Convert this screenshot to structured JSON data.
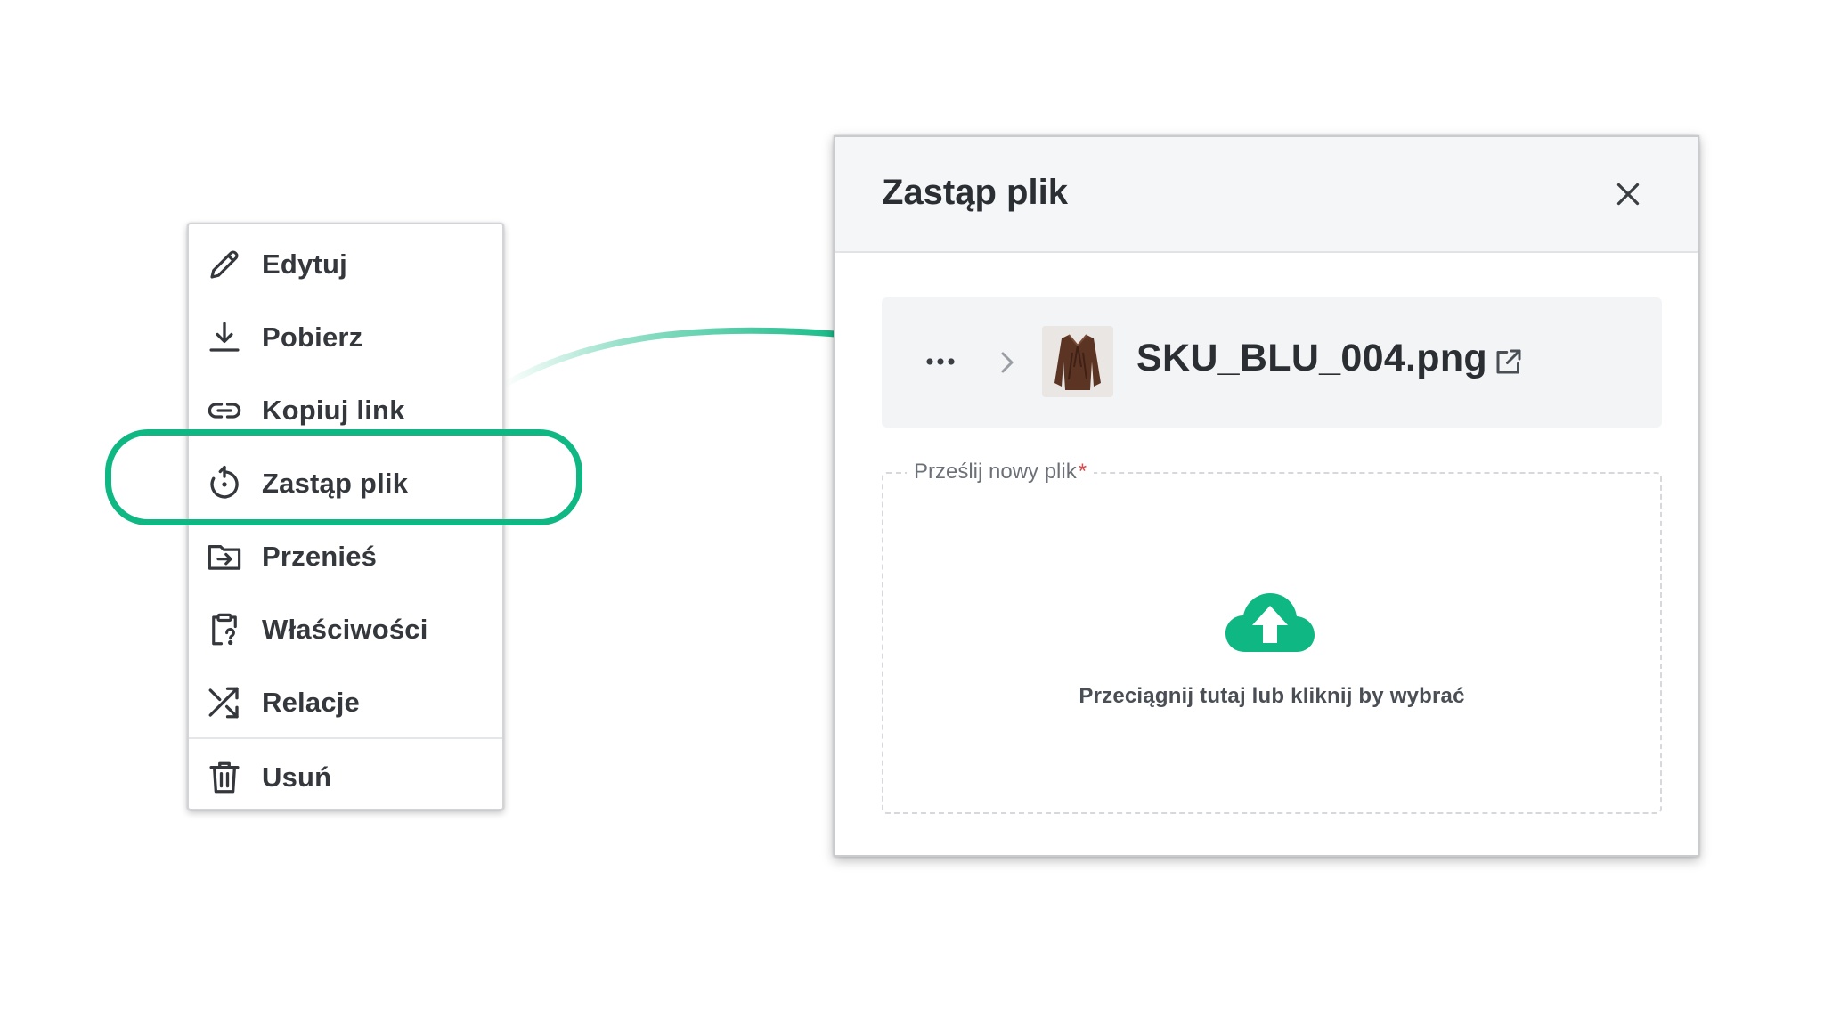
{
  "context_menu": {
    "items": [
      {
        "label": "Edytuj",
        "icon": "pencil-icon"
      },
      {
        "label": "Pobierz",
        "icon": "download-icon"
      },
      {
        "label": "Kopiuj link",
        "icon": "link-icon"
      },
      {
        "label": "Zastąp plik",
        "icon": "replace-icon"
      },
      {
        "label": "Przenieś",
        "icon": "move-folder-icon"
      },
      {
        "label": "Właściwości",
        "icon": "clipboard-question-icon"
      },
      {
        "label": "Relacje",
        "icon": "shuffle-icon"
      },
      {
        "label": "Usuń",
        "icon": "trash-icon"
      }
    ],
    "highlighted_item": "Zastąp plik"
  },
  "modal": {
    "title": "Zastąp plik",
    "file": {
      "name": "SKU_BLU_004.png",
      "thumbnail": "brown-blouse-thumbnail"
    },
    "upload": {
      "label": "Prześlij nowy plik",
      "required_mark": "*",
      "hint": "Przeciągnij tutaj lub kliknij by wybrać"
    }
  },
  "colors": {
    "accent": "#0fb883",
    "required": "#e04848",
    "header_bg": "#f5f6f7"
  }
}
